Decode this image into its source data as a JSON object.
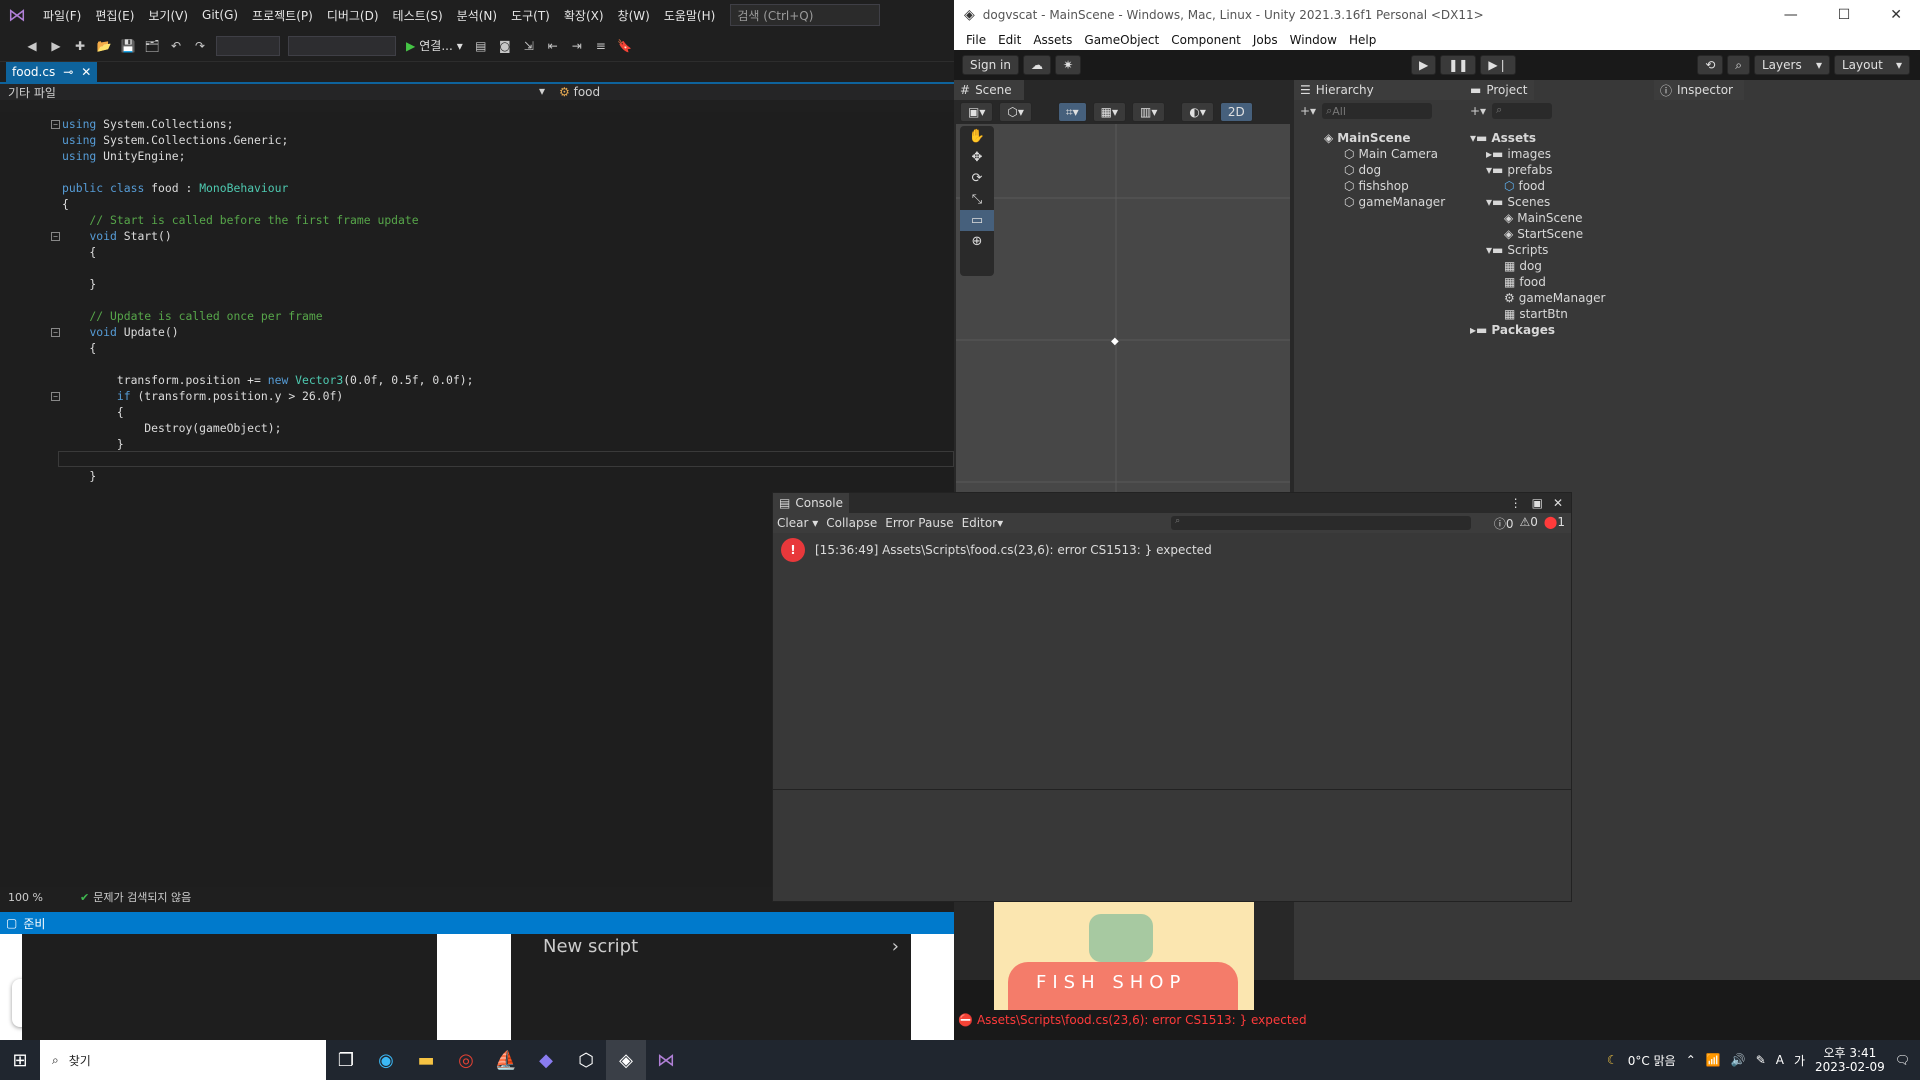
{
  "vs": {
    "menu": [
      "파일(F)",
      "편집(E)",
      "보기(V)",
      "Git(G)",
      "프로젝트(P)",
      "디버그(D)",
      "테스트(S)",
      "분석(N)",
      "도구(T)",
      "확장(X)",
      "창(W)",
      "도움말(H)"
    ],
    "search_placeholder": "검색 (Ctrl+Q)",
    "connect_label": "연결...",
    "tab_label": "food.cs",
    "nav_left": "기타 파일",
    "nav_right": "food",
    "code": [
      {
        "t": "using System.Collections;"
      },
      {
        "t": "using System.Collections.Generic;"
      },
      {
        "t": "using UnityEngine;"
      },
      {
        "t": ""
      },
      {
        "t": "public class food : MonoBehaviour"
      },
      {
        "t": "{"
      },
      {
        "t": "    // Start is called before the first frame update"
      },
      {
        "t": "    void Start()"
      },
      {
        "t": "    {"
      },
      {
        "t": ""
      },
      {
        "t": "    }"
      },
      {
        "t": ""
      },
      {
        "t": "    // Update is called once per frame"
      },
      {
        "t": "    void Update()"
      },
      {
        "t": "    {"
      },
      {
        "t": ""
      },
      {
        "t": "        transform.position += new Vector3(0.0f, 0.5f, 0.0f);"
      },
      {
        "t": "        if (transform.position.y > 26.0f)"
      },
      {
        "t": "        {"
      },
      {
        "t": "            Destroy(gameObject);"
      },
      {
        "t": "        }"
      },
      {
        "t": ""
      },
      {
        "t": "    }"
      }
    ],
    "zoom": "100 %",
    "issues": "문제가 검색되지 않음",
    "status": "준비",
    "new_script": "New script"
  },
  "unity": {
    "title": "dogvscat - MainScene - Windows, Mac, Linux - Unity 2021.3.16f1 Personal <DX11>",
    "menu": [
      "File",
      "Edit",
      "Assets",
      "GameObject",
      "Component",
      "Jobs",
      "Window",
      "Help"
    ],
    "sign_in": "Sign in",
    "layers": "Layers",
    "layout": "Layout",
    "scene_tab": "Scene",
    "hierarchy_tab": "Hierarchy",
    "project_tab": "Project",
    "inspector_tab": "Inspector",
    "two_d": "2D",
    "hier_search": "All",
    "hierarchy": [
      "MainScene",
      "Main Camera",
      "dog",
      "fishshop",
      "gameManager"
    ],
    "project": [
      "Assets",
      "images",
      "prefabs",
      "food",
      "Scenes",
      "MainScene",
      "StartScene",
      "Scripts",
      "dog",
      "food",
      "gameManager",
      "startBtn",
      "Packages"
    ],
    "console": {
      "tab": "Console",
      "clear": "Clear",
      "collapse": "Collapse",
      "error_pause": "Error Pause",
      "editor": "Editor",
      "counts": [
        "0",
        "0",
        "1"
      ],
      "message": "[15:36:49] Assets\\Scripts\\food.cs(23,6): error CS1513: } expected"
    },
    "status_error": "Assets\\Scripts\\food.cs(23,6): error CS1513: } expected",
    "fishshop_text": "FISH SHOP"
  },
  "taskbar": {
    "search": "찾기",
    "weather": "0°C 맑음",
    "ime": "A",
    "time": "오후 3:41",
    "date": "2023-02-09"
  }
}
